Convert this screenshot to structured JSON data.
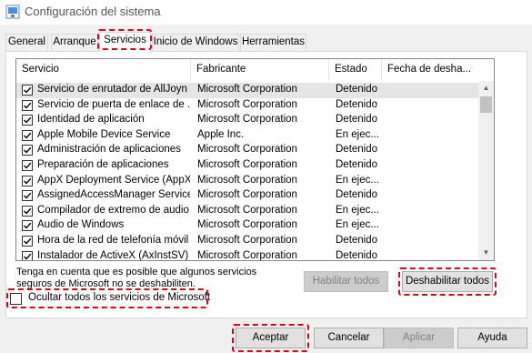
{
  "window": {
    "title": "Configuración del sistema"
  },
  "tabs": [
    {
      "label": "General"
    },
    {
      "label": "Arranque"
    },
    {
      "label": "Servicios"
    },
    {
      "label": "Inicio de Windows"
    },
    {
      "label": "Herramientas"
    }
  ],
  "list": {
    "columns": [
      "Servicio",
      "Fabricante",
      "Estado",
      "Fecha de desha..."
    ],
    "rows": [
      {
        "service": "Servicio de enrutador de AllJoyn",
        "vendor": "Microsoft Corporation",
        "status": "Detenido",
        "checked": true
      },
      {
        "service": "Servicio de puerta de enlace de ...",
        "vendor": "Microsoft Corporation",
        "status": "Detenido",
        "checked": true
      },
      {
        "service": "Identidad de aplicación",
        "vendor": "Microsoft Corporation",
        "status": "Detenido",
        "checked": true
      },
      {
        "service": "Apple Mobile Device Service",
        "vendor": "Apple Inc.",
        "status": "En ejec...",
        "checked": true
      },
      {
        "service": "Administración de aplicaciones",
        "vendor": "Microsoft Corporation",
        "status": "Detenido",
        "checked": true
      },
      {
        "service": "Preparación de aplicaciones",
        "vendor": "Microsoft Corporation",
        "status": "Detenido",
        "checked": true
      },
      {
        "service": "AppX Deployment Service (AppX...",
        "vendor": "Microsoft Corporation",
        "status": "En ejec...",
        "checked": true
      },
      {
        "service": "AssignedAccessManager Service",
        "vendor": "Microsoft Corporation",
        "status": "Detenido",
        "checked": true
      },
      {
        "service": "Compilador de extremo de audio...",
        "vendor": "Microsoft Corporation",
        "status": "En ejec...",
        "checked": true
      },
      {
        "service": "Audio de Windows",
        "vendor": "Microsoft Corporation",
        "status": "En ejec...",
        "checked": true
      },
      {
        "service": "Hora de la red de telefonía móvil",
        "vendor": "Microsoft Corporation",
        "status": "Detenido",
        "checked": true
      },
      {
        "service": "Instalador de ActiveX (AxInstSV)",
        "vendor": "Microsoft Corporation",
        "status": "Detenido",
        "checked": true
      }
    ]
  },
  "note": "Tenga en cuenta que es posible que algunos servicios seguros de Microsoft no se deshabiliten.",
  "hide_ms": {
    "label": "Ocultar todos los servicios de Microsoft",
    "checked": false
  },
  "buttons": {
    "enable_all": "Habilitar todos",
    "disable_all": "Deshabilitar todos",
    "ok": "Aceptar",
    "cancel": "Cancelar",
    "apply": "Aplicar",
    "help": "Ayuda"
  },
  "icons": {
    "app": "system-config-icon",
    "checkmark": "check-icon",
    "scroll_up": "chevron-up-icon",
    "scroll_down": "chevron-down-icon"
  },
  "colors": {
    "highlight": "#e0001a",
    "accent": "#0078d7"
  }
}
